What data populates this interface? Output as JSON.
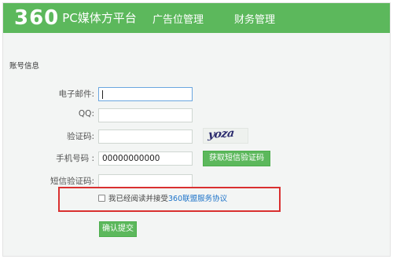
{
  "header": {
    "logo_mark": "360",
    "logo_text": "PC媒体方平台",
    "nav": [
      {
        "label": "广告位管理"
      },
      {
        "label": "财务管理"
      }
    ]
  },
  "section": {
    "title": "账号信息"
  },
  "form": {
    "email": {
      "label": "电子邮件:",
      "value": ""
    },
    "qq": {
      "label": "QQ:",
      "value": ""
    },
    "captcha": {
      "label": "验证码:",
      "value": "",
      "image_text": "yoza"
    },
    "phone": {
      "label": "手机号码 :",
      "value": "00000000000"
    },
    "sms_button": "获取短信验证码",
    "sms_code": {
      "label": "短信验证码:",
      "value": ""
    },
    "agree_prefix": "我已经阅读并接受",
    "agree_link": "360联盟服务协议",
    "agree_checked": false,
    "submit": "确认提交"
  },
  "colors": {
    "header_green": "#5cb85c",
    "button_green": "#5cb85c",
    "highlight_red": "#d93030",
    "link_blue": "#1d73c9"
  }
}
